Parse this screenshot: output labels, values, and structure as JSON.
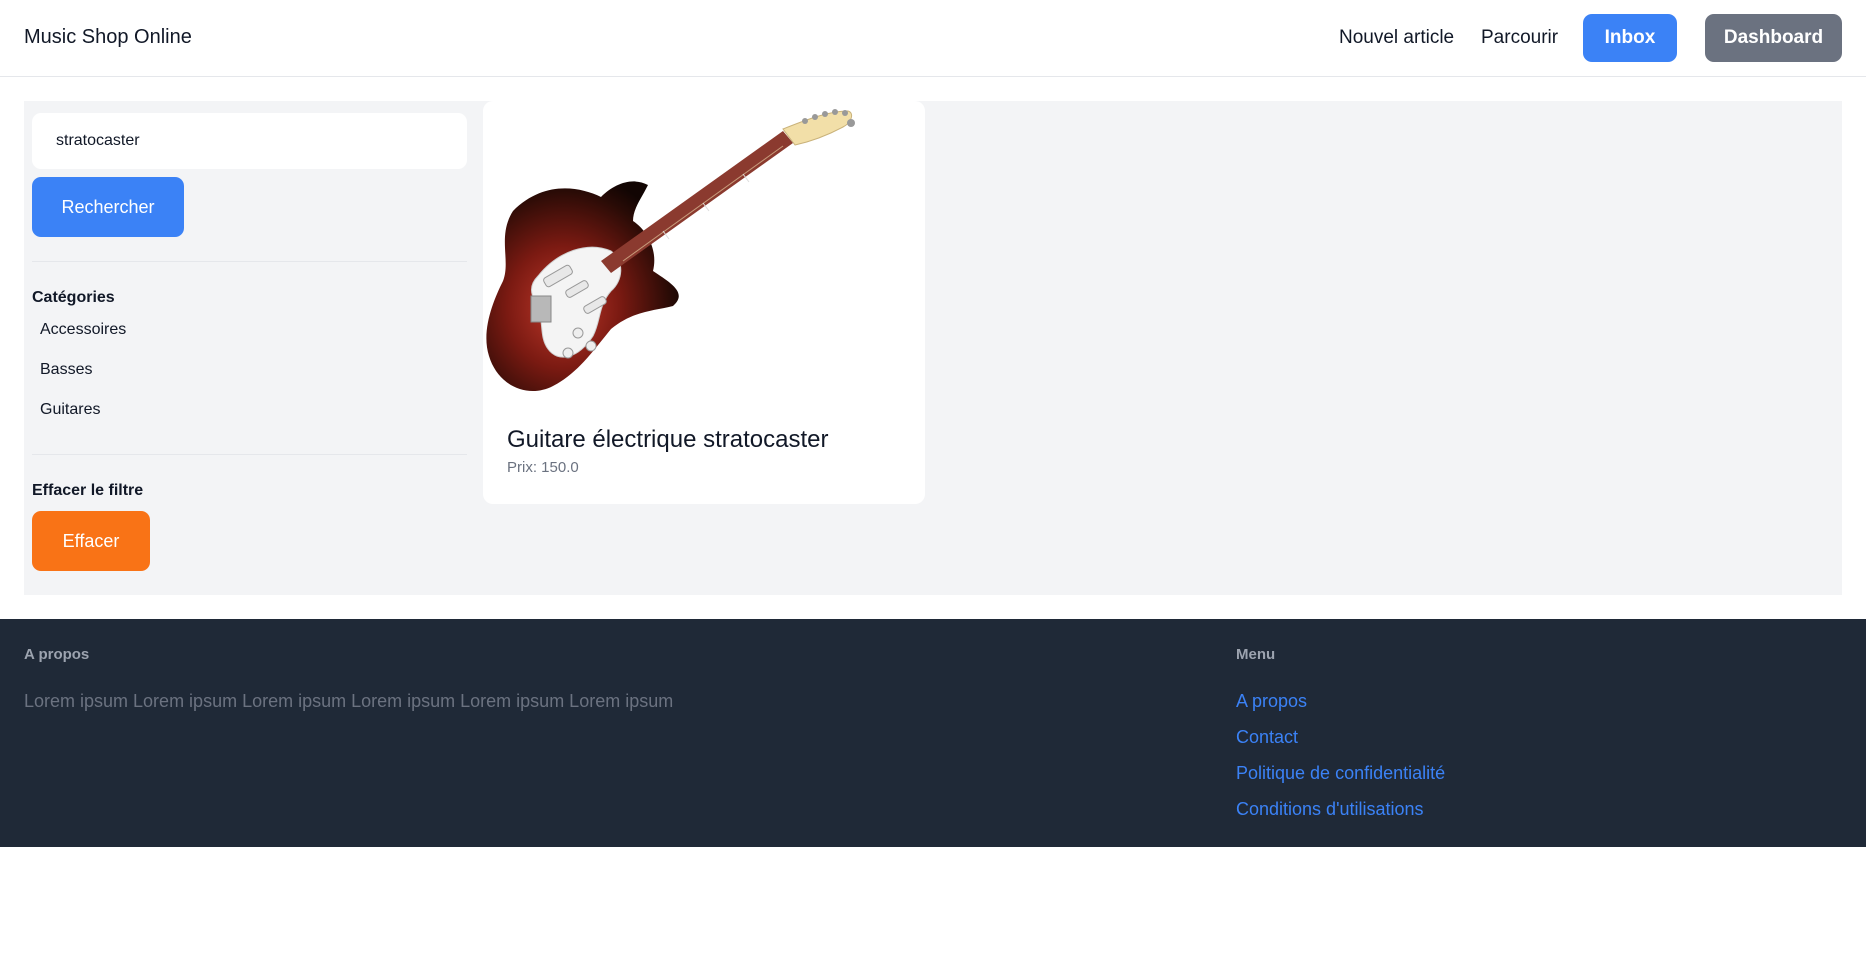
{
  "header": {
    "brand": "Music Shop Online",
    "nav": {
      "new_item": "Nouvel article",
      "browse": "Parcourir",
      "inbox": "Inbox",
      "dashboard": "Dashboard"
    }
  },
  "sidebar": {
    "search_value": "stratocaster",
    "search_button": "Rechercher",
    "categories_title": "Catégories",
    "categories": [
      "Accessoires",
      "Basses",
      "Guitares"
    ],
    "clear_title": "Effacer le filtre",
    "clear_button": "Effacer"
  },
  "products": [
    {
      "title": "Guitare électrique stratocaster",
      "price": "Prix: 150.0"
    }
  ],
  "footer": {
    "about_title": "A propos",
    "about_text": "Lorem ipsum Lorem ipsum Lorem ipsum Lorem ipsum Lorem ipsum Lorem ipsum",
    "menu_title": "Menu",
    "links": [
      "A propos",
      "Contact",
      "Politique de confidentialité",
      "Conditions d'utilisations"
    ]
  },
  "colors": {
    "primary": "#3b82f6",
    "secondary": "#6b7280",
    "orange": "#f97316",
    "footer_bg": "#1f2937",
    "content_bg": "#f3f4f6"
  },
  "icons": [
    "electric-guitar-image"
  ]
}
